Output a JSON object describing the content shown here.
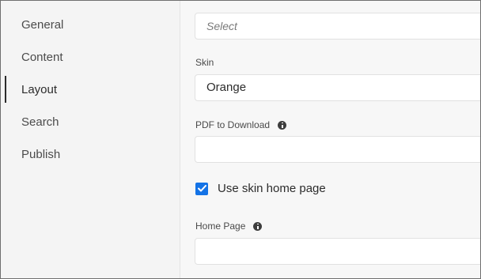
{
  "sidebar": {
    "items": [
      {
        "label": "General"
      },
      {
        "label": "Content"
      },
      {
        "label": "Layout",
        "active": true
      },
      {
        "label": "Search"
      },
      {
        "label": "Publish"
      }
    ]
  },
  "form": {
    "top_select": {
      "placeholder": "Select"
    },
    "skin": {
      "label": "Skin",
      "value": "Orange"
    },
    "pdf": {
      "label": "PDF to Download",
      "value": ""
    },
    "use_skin_home": {
      "label": "Use skin home page",
      "checked": true
    },
    "home_page": {
      "label": "Home Page",
      "value": ""
    }
  },
  "colors": {
    "accent": "#1473e6"
  }
}
